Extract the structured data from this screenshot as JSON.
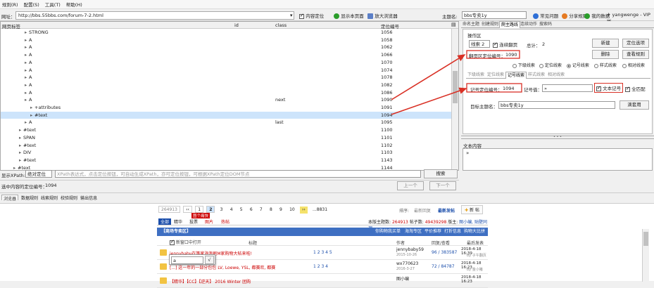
{
  "menu": [
    "规则(R)",
    "配置(S)",
    "工具(T)",
    "帮助(H)"
  ],
  "urlbar": {
    "label": "网址：",
    "url": "http://bbs.55bbs.com/forum-7-2.html",
    "content_locate": "内容定位",
    "show_page": "显示本页面",
    "zoom": "放大浏览器",
    "topic_label": "主题名:",
    "topic": "bbs专卖1y",
    "faq": "常见问题",
    "share": "分享规则",
    "wealth": "我的数据",
    "user": "yangwenge - VIP版"
  },
  "tree": {
    "headers": {
      "node": "网页标签",
      "id": "id",
      "class": "class",
      "pos": "定位编号"
    },
    "rows": [
      {
        "node": "STRONG",
        "class": "",
        "pos": "1056",
        "indent": 4,
        "sel": false
      },
      {
        "node": "A",
        "class": "",
        "pos": "1058",
        "indent": 4,
        "sel": false
      },
      {
        "node": "A",
        "class": "",
        "pos": "1062",
        "indent": 4,
        "sel": false
      },
      {
        "node": "A",
        "class": "",
        "pos": "1066",
        "indent": 4,
        "sel": false
      },
      {
        "node": "A",
        "class": "",
        "pos": "1070",
        "indent": 4,
        "sel": false
      },
      {
        "node": "A",
        "class": "",
        "pos": "1074",
        "indent": 4,
        "sel": false
      },
      {
        "node": "A",
        "class": "",
        "pos": "1078",
        "indent": 4,
        "sel": false
      },
      {
        "node": "A",
        "class": "",
        "pos": "1082",
        "indent": 4,
        "sel": false
      },
      {
        "node": "A",
        "class": "",
        "pos": "1086",
        "indent": 4,
        "sel": false
      },
      {
        "node": "A",
        "class": "next",
        "pos": "1090",
        "indent": 4,
        "sel": false
      },
      {
        "node": "+attributes",
        "class": "",
        "pos": "1091",
        "indent": 5,
        "sel": false
      },
      {
        "node": "#text",
        "class": "",
        "pos": "1094",
        "indent": 5,
        "sel": true
      },
      {
        "node": "A",
        "class": "last",
        "pos": "1095",
        "indent": 4,
        "sel": false
      },
      {
        "node": "#text",
        "class": "",
        "pos": "1100",
        "indent": 3,
        "sel": false
      },
      {
        "node": "SPAN",
        "class": "",
        "pos": "1101",
        "indent": 3,
        "sel": false
      },
      {
        "node": "#text",
        "class": "",
        "pos": "1102",
        "indent": 3,
        "sel": false
      },
      {
        "node": "DIV",
        "class": "",
        "pos": "1103",
        "indent": 3,
        "sel": false
      },
      {
        "node": "#text",
        "class": "",
        "pos": "1143",
        "indent": 3,
        "sel": false
      },
      {
        "node": "#text",
        "class": "",
        "pos": "1144",
        "indent": 2,
        "sel": false
      }
    ]
  },
  "xpath": {
    "label": "显示XPath:",
    "mode": "绝对定位",
    "placeholder": "XPath表达式，点击定位按钮，可自动生成XPath，亦可定位按钮，可根据XPath定位DOM节点",
    "search": "搜索",
    "status_label": "选中内容的定位编号：",
    "status_value": "1094",
    "prev": "上一个",
    "next": "下一个"
  },
  "right": {
    "tabs": [
      "命名主题",
      "创建规则",
      "爬主路线",
      "连续动作",
      "搜索码"
    ],
    "group_title": "操作区",
    "clue_select": "线索 2",
    "continue_page": "连续翻页",
    "total_label": "总计：",
    "total": "2",
    "btn_new": "新建",
    "btn_locate": "定位选项",
    "page_pos_label": "翻页区定位编号：",
    "page_pos": "1090",
    "btn_delete": "删除",
    "btn_view": "查看规则",
    "radios": [
      "下级线索",
      "定位线索",
      "记号线索",
      "样式线索",
      "相对线索"
    ],
    "subtabs": [
      "下级线索",
      "定位线索",
      "记号线索",
      "样式线索",
      "相对线索"
    ],
    "mark_pos_label": "记号定位编号：",
    "mark_pos": "1094",
    "mark_value_label": "记号值：",
    "mark_value": "»",
    "text_mark": "文本记号",
    "whole_match": "全匹配",
    "target_label": "目标主题名：",
    "target": "bbs专卖1y",
    "btn_apply": "滴套用",
    "text_content_label": "文本内容",
    "text_content": "»"
  },
  "bottom_tabs": [
    "浏览器",
    "数据规则",
    "线索规则",
    "校验规则",
    "输出信息"
  ],
  "forum": {
    "pages": [
      "264913",
      "‹‹",
      "1",
      "2",
      "3",
      "4",
      "5",
      "6",
      "7",
      "8",
      "9",
      "10",
      "››",
      "...8831"
    ],
    "sort": "排序:",
    "latest_reply": "最新回复",
    "latest_post": "最新发帖",
    "new_post": "新 帖",
    "tabs": [
      "全部",
      "精华",
      "投票",
      "图片",
      "热帖"
    ],
    "tab_badge": "图片",
    "tab_tooltip": "图个痛快",
    "stats_prefix": "本版主题数:",
    "stats_topics": "264913",
    "stats_mid": "帖子数:",
    "stats_posts": "49439298",
    "stats_mods_label": "版主:",
    "stats_mods": "图小编, 贴壁同理",
    "banner": "【商场专卖区】",
    "banner_links": [
      "你购物我买单",
      "海淘专区",
      "平价推荐",
      "打折信息",
      "购物大比拼"
    ],
    "new_window": "新窗口中打开",
    "col_title": "标题",
    "col_author": "作者",
    "col_reply": "回复/查看",
    "col_last": "最后发表",
    "rows": [
      {
        "title": "jennybaby在等家海淘刷M家购物大帖来啦!",
        "pages": "1 2 3 4 5",
        "author": "jennybaby59",
        "date": "2015-10-26",
        "count": "96 / 383587",
        "last": "2018-4-18 16:39",
        "by": "by 子午翻页"
      },
      {
        "title": "[...] 这一年的一部分包包 LV, Loewe, YSL, 都赛欢, 都赛",
        "pages": "1 2 3 4",
        "author": "wx770623",
        "date": "2016-3-27",
        "count": "72 / 84787",
        "last": "2018-4-18 16:23",
        "by": "by 金小猪"
      },
      {
        "title": "【精华】【CC】【逆天】 2016 Winter 团购",
        "pages": "",
        "author": "图小编",
        "date": "",
        "count": "",
        "last": "2018-4-18 16:23",
        "by": ""
      }
    ],
    "popup_input": "a",
    "popup_btn": "√"
  }
}
